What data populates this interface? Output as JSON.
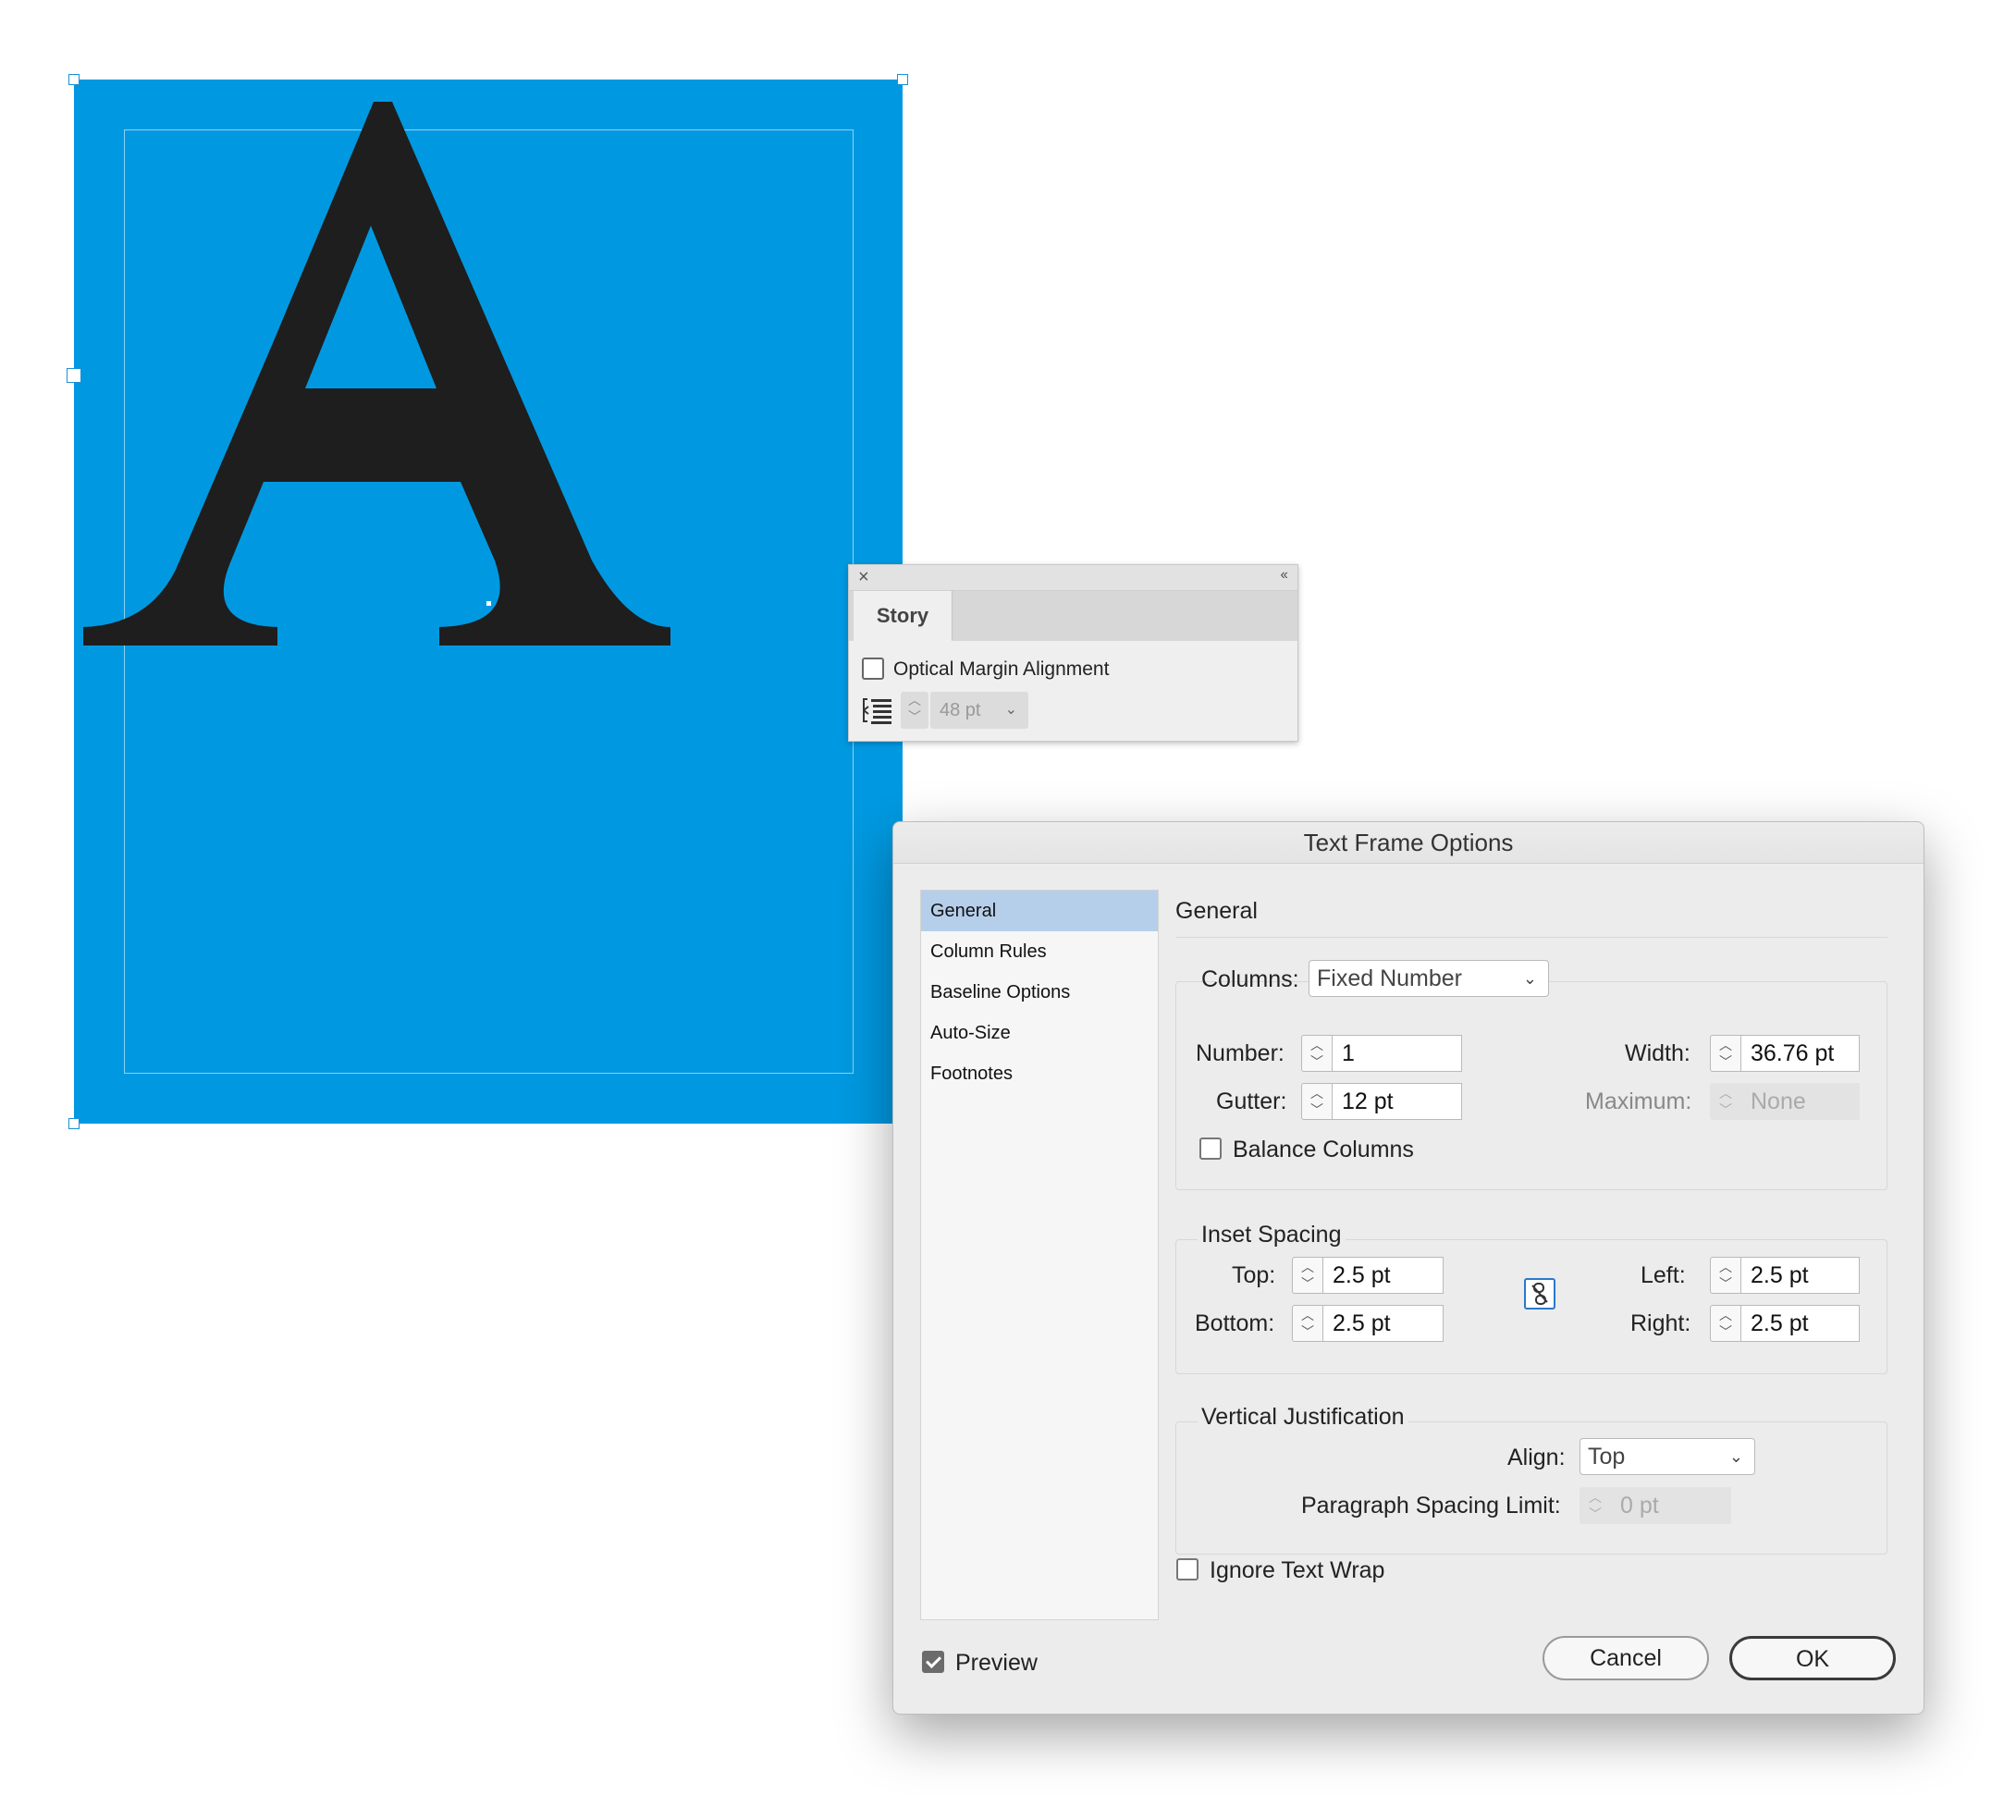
{
  "canvas": {
    "glyph": "A"
  },
  "story_panel": {
    "close_label": "×",
    "collapse_label": "‹‹",
    "tab_label": "Story",
    "optical_margin_label": "Optical Margin Alignment",
    "optical_margin_checked": false,
    "size_value": "48 pt"
  },
  "dialog": {
    "title": "Text Frame Options",
    "sidebar": [
      "General",
      "Column Rules",
      "Baseline Options",
      "Auto-Size",
      "Footnotes"
    ],
    "selected": "General",
    "section_title": "General",
    "columns": {
      "label": "Columns:",
      "mode": "Fixed Number",
      "number_label": "Number:",
      "number_value": "1",
      "gutter_label": "Gutter:",
      "gutter_value": "12 pt",
      "width_label": "Width:",
      "width_value": "36.76 pt",
      "maximum_label": "Maximum:",
      "maximum_value": "None",
      "balance_label": "Balance Columns"
    },
    "inset": {
      "label": "Inset Spacing",
      "top_label": "Top:",
      "top_value": "2.5 pt",
      "bottom_label": "Bottom:",
      "bottom_value": "2.5 pt",
      "left_label": "Left:",
      "left_value": "2.5 pt",
      "right_label": "Right:",
      "right_value": "2.5 pt"
    },
    "vertical": {
      "label": "Vertical Justification",
      "align_label": "Align:",
      "align_value": "Top",
      "psl_label": "Paragraph Spacing Limit:",
      "psl_value": "0 pt"
    },
    "ignore_wrap_label": "Ignore Text Wrap",
    "preview_label": "Preview",
    "preview_checked": true,
    "cancel_label": "Cancel",
    "ok_label": "OK"
  },
  "colors": {
    "frame_fill": "#0099e1",
    "selection_highlight": "#b5cfea",
    "link_icon": "#2a79c9"
  }
}
